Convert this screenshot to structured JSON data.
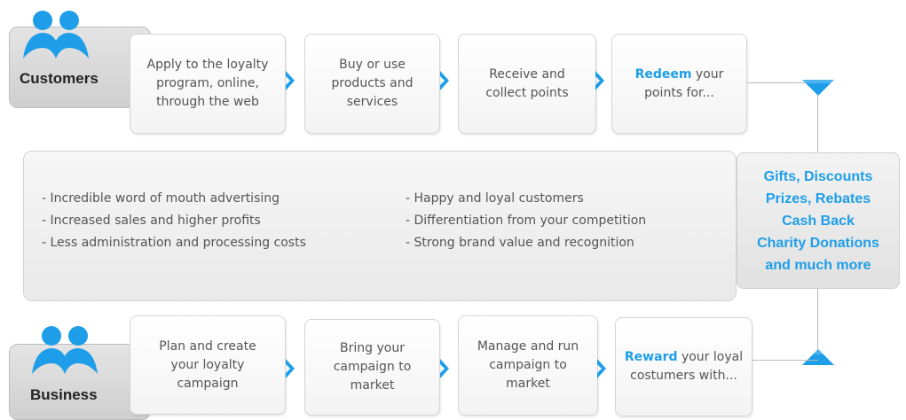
{
  "groups": {
    "customers": "Customers",
    "business": "Business"
  },
  "customer_steps": [
    {
      "pre": "",
      "highlight": "",
      "text": "Apply to the loyalty program, online, through the web"
    },
    {
      "pre": "",
      "highlight": "",
      "text": "Buy or use products and services"
    },
    {
      "pre": "",
      "highlight": "",
      "text": "Receive and collect points"
    },
    {
      "pre": "",
      "highlight": "Redeem",
      "text": " your points for..."
    }
  ],
  "business_steps": [
    {
      "highlight": "",
      "text": "Plan and create your loyalty campaign"
    },
    {
      "highlight": "",
      "text": "Bring your campaign to market"
    },
    {
      "highlight": "",
      "text": "Manage and run campaign to market"
    },
    {
      "highlight": "Reward",
      "text": " your loyal costumers with..."
    }
  ],
  "benefits": {
    "left": [
      "- Incredible word of mouth advertising",
      "- Increased sales and higher profits",
      "- Less administration and processing costs"
    ],
    "right": [
      "- Happy and loyal customers",
      "- Differentiation from your competition",
      "- Strong brand value and recognition"
    ]
  },
  "rewards": [
    "Gifts, Discounts",
    "Prizes, Rebates",
    "Cash Back",
    "Charity Donations",
    "and much more"
  ],
  "colors": {
    "accent": "#1e9ee8",
    "people_icon": "#1e9ee8",
    "text": "#555555"
  },
  "icons": {
    "group": "people-group-icon",
    "step_arrow": "chevron-right-icon",
    "down": "triangle-down-icon",
    "up": "triangle-up-icon"
  }
}
